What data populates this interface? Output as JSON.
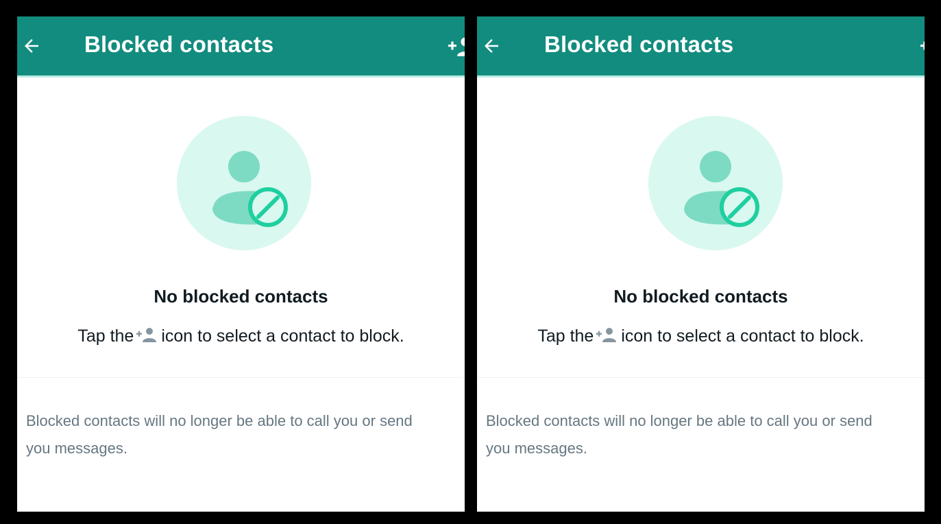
{
  "colors": {
    "app_bar": "#128c7e",
    "app_bar_underline": "#b7ece2",
    "illustration_bg": "#d9f8f0",
    "illustration_figure": "#7ddbc3",
    "block_badge": "#1fcf9f",
    "primary_text": "#111b21",
    "secondary_text": "#667781",
    "hint_icon": "#8696a0"
  },
  "screens": [
    {
      "header": {
        "back_icon": "back-arrow-icon",
        "title": "Blocked contacts",
        "action_icon": "add-contact-icon"
      },
      "empty_state": {
        "illustration_icon": "blocked-user-icon",
        "title": "No blocked contacts",
        "hint_before": "Tap the",
        "hint_icon": "add-contact-icon",
        "hint_after": "icon to select a contact to block."
      },
      "info": "Blocked contacts will no longer be able to call you or send you messages."
    },
    {
      "header": {
        "back_icon": "back-arrow-icon",
        "title": "Blocked contacts",
        "action_icon": "add-contact-icon"
      },
      "empty_state": {
        "illustration_icon": "blocked-user-icon",
        "title": "No blocked contacts",
        "hint_before": "Tap the",
        "hint_icon": "add-contact-icon",
        "hint_after": "icon to select a contact to block."
      },
      "info": "Blocked contacts will no longer be able to call you or send you messages."
    }
  ]
}
